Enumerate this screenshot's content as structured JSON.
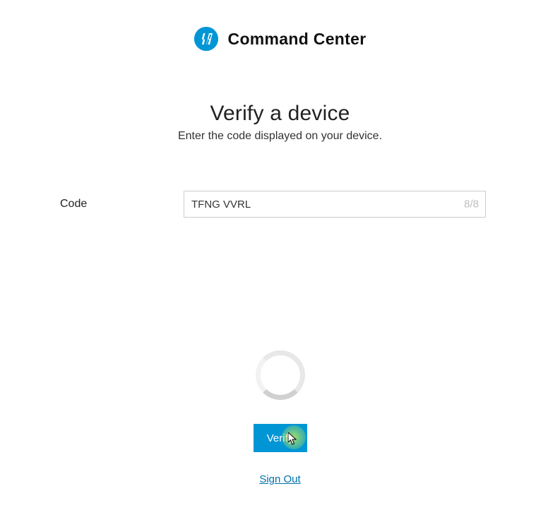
{
  "header": {
    "logo_name": "hp-logo-icon",
    "title": "Command Center"
  },
  "main": {
    "title": "Verify a device",
    "subtitle": "Enter the code displayed on your device."
  },
  "form": {
    "code_label": "Code",
    "code_value": "TFNG VVRL",
    "char_count": "8/8"
  },
  "actions": {
    "verify_label": "Verify",
    "signout_label": "Sign Out"
  },
  "colors": {
    "brand": "#0096d6",
    "link": "#0073a8"
  }
}
